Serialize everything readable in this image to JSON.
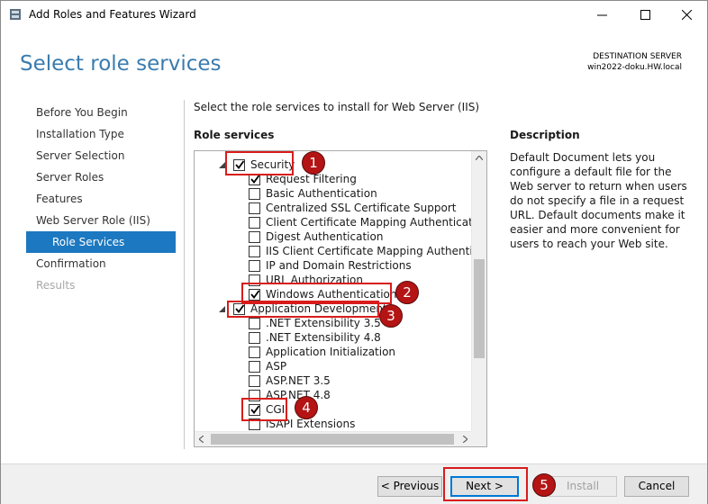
{
  "window": {
    "title": "Add Roles and Features Wizard",
    "controls": {
      "minimize": "—",
      "maximize": "☐",
      "close": "✕"
    }
  },
  "header": {
    "page_title": "Select role services",
    "destination_label": "DESTINATION SERVER",
    "destination_server": "win2022-doku.HW.local"
  },
  "nav": {
    "items": [
      {
        "label": "Before You Begin",
        "state": "normal"
      },
      {
        "label": "Installation Type",
        "state": "normal"
      },
      {
        "label": "Server Selection",
        "state": "normal"
      },
      {
        "label": "Server Roles",
        "state": "normal"
      },
      {
        "label": "Features",
        "state": "normal"
      },
      {
        "label": "Web Server Role (IIS)",
        "state": "normal"
      },
      {
        "label": "Role Services",
        "state": "active"
      },
      {
        "label": "Confirmation",
        "state": "normal"
      },
      {
        "label": "Results",
        "state": "disabled"
      }
    ]
  },
  "main": {
    "instruction": "Select the role services to install for Web Server (IIS)",
    "role_services_label": "Role services",
    "tree": [
      {
        "label": "Security",
        "checked": true,
        "level": 0,
        "expander": true
      },
      {
        "label": "Request Filtering",
        "checked": true,
        "level": 1
      },
      {
        "label": "Basic Authentication",
        "checked": false,
        "level": 1
      },
      {
        "label": "Centralized SSL Certificate Support",
        "checked": false,
        "level": 1
      },
      {
        "label": "Client Certificate Mapping Authentication",
        "checked": false,
        "level": 1
      },
      {
        "label": "Digest Authentication",
        "checked": false,
        "level": 1
      },
      {
        "label": "IIS Client Certificate Mapping Authenticatic",
        "checked": false,
        "level": 1
      },
      {
        "label": "IP and Domain Restrictions",
        "checked": false,
        "level": 1
      },
      {
        "label": "URL Authorization",
        "checked": false,
        "level": 1
      },
      {
        "label": "Windows Authentication",
        "checked": true,
        "level": 1
      },
      {
        "label": "Application Development",
        "checked": true,
        "level": 0,
        "expander": true
      },
      {
        "label": ".NET Extensibility 3.5",
        "checked": false,
        "level": 1
      },
      {
        "label": ".NET Extensibility 4.8",
        "checked": false,
        "level": 1
      },
      {
        "label": "Application Initialization",
        "checked": false,
        "level": 1
      },
      {
        "label": "ASP",
        "checked": false,
        "level": 1
      },
      {
        "label": "ASP.NET 3.5",
        "checked": false,
        "level": 1
      },
      {
        "label": "ASP.NET 4.8",
        "checked": false,
        "level": 1
      },
      {
        "label": "CGI",
        "checked": true,
        "level": 1
      },
      {
        "label": "ISAPI Extensions",
        "checked": false,
        "level": 1
      }
    ]
  },
  "description": {
    "label": "Description",
    "text": "Default Document lets you configure a default file for the Web server to return when users do not specify a file in a request URL. Default documents make it easier and more convenient for users to reach your Web site."
  },
  "annotations": [
    "1",
    "2",
    "3",
    "4",
    "5"
  ],
  "footer": {
    "previous": "< Previous",
    "next": "Next >",
    "install": "Install",
    "cancel": "Cancel"
  },
  "colors": {
    "accent": "#1c78c0",
    "title_blue": "#3a7cae",
    "annotation_red": "#d81c1c",
    "badge_fill": "#b41414"
  }
}
